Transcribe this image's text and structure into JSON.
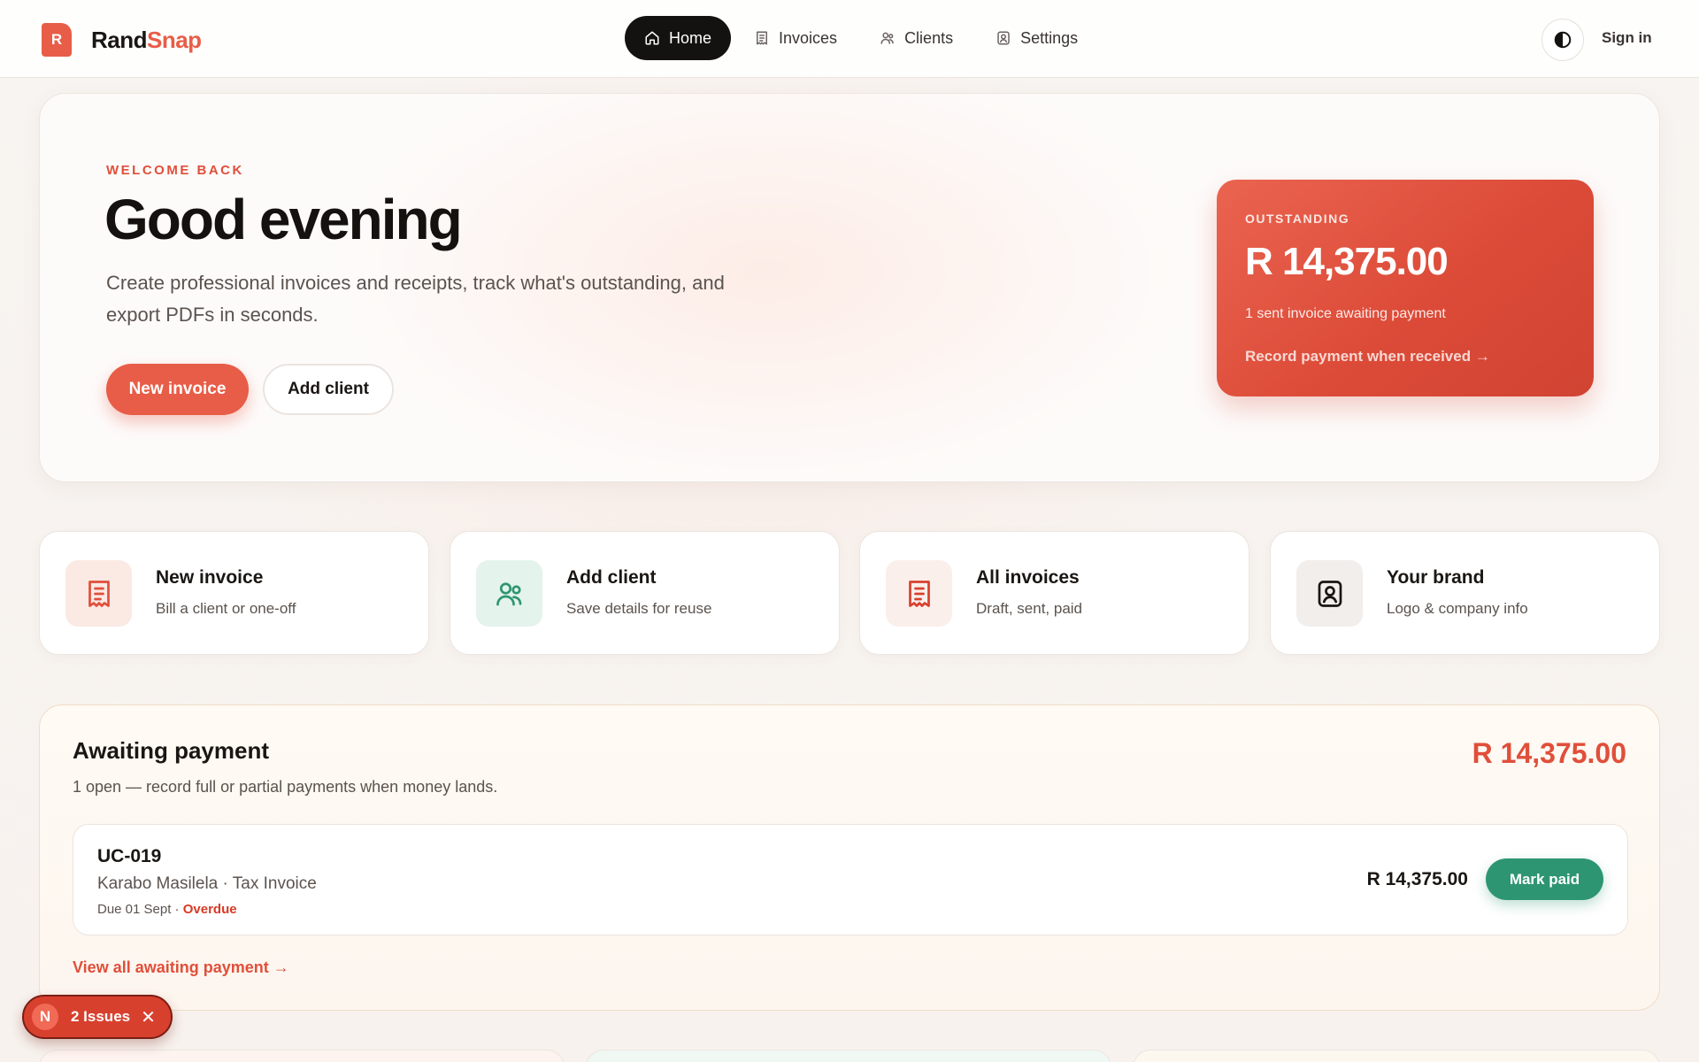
{
  "app": {
    "name_part1": "Rand",
    "name_part2": "Snap",
    "logo_letter": "R",
    "brand_color": "#e85d47"
  },
  "nav": {
    "items": [
      {
        "label": "Home",
        "icon": "home-icon",
        "active": true
      },
      {
        "label": "Invoices",
        "icon": "receipt-icon",
        "active": false
      },
      {
        "label": "Clients",
        "icon": "users-icon",
        "active": false
      },
      {
        "label": "Settings",
        "icon": "id-badge-icon",
        "active": false
      }
    ],
    "theme_toggle_icon": "contrast-icon",
    "signin_label": "Sign in"
  },
  "hero": {
    "eyebrow": "WELCOME BACK",
    "title": "Good evening",
    "subtitle": "Create professional invoices and receipts, track what's outstanding, and export PDFs in seconds.",
    "primary_button": "New invoice",
    "secondary_button": "Add client",
    "outstanding": {
      "label": "OUTSTANDING",
      "amount": "R 14,375.00",
      "description": "1 sent invoice awaiting payment",
      "link": "Record payment when received →"
    }
  },
  "quick_actions": [
    {
      "title": "New invoice",
      "subtitle": "Bill a client or one-off",
      "icon": "receipt-icon",
      "icon_bg": "#fbe9e4",
      "icon_color": "#e04f3a"
    },
    {
      "title": "Add client",
      "subtitle": "Save details for reuse",
      "icon": "users-icon",
      "icon_bg": "#e4f3ec",
      "icon_color": "#2e9573"
    },
    {
      "title": "All invoices",
      "subtitle": "Draft, sent, paid",
      "icon": "receipt-icon",
      "icon_bg": "#fbefeb",
      "icon_color": "#d8402e"
    },
    {
      "title": "Your brand",
      "subtitle": "Logo & company info",
      "icon": "id-badge-icon",
      "icon_bg": "#f1eeeb",
      "icon_color": "#1a1614"
    }
  ],
  "awaiting": {
    "title": "Awaiting payment",
    "subtitle": "1 open — record full or partial payments when money lands.",
    "total": "R 14,375.00",
    "invoices": [
      {
        "id": "UC-019",
        "client_line": "Karabo Masilela · Tax Invoice",
        "due": "Due 01 Sept · ",
        "status": "Overdue",
        "amount": "R 14,375.00",
        "action": "Mark paid"
      }
    ],
    "view_all_link": "View all awaiting payment →"
  },
  "issues_badge": {
    "logo_letter": "N",
    "text": "2 Issues",
    "close_icon": "close-icon"
  }
}
